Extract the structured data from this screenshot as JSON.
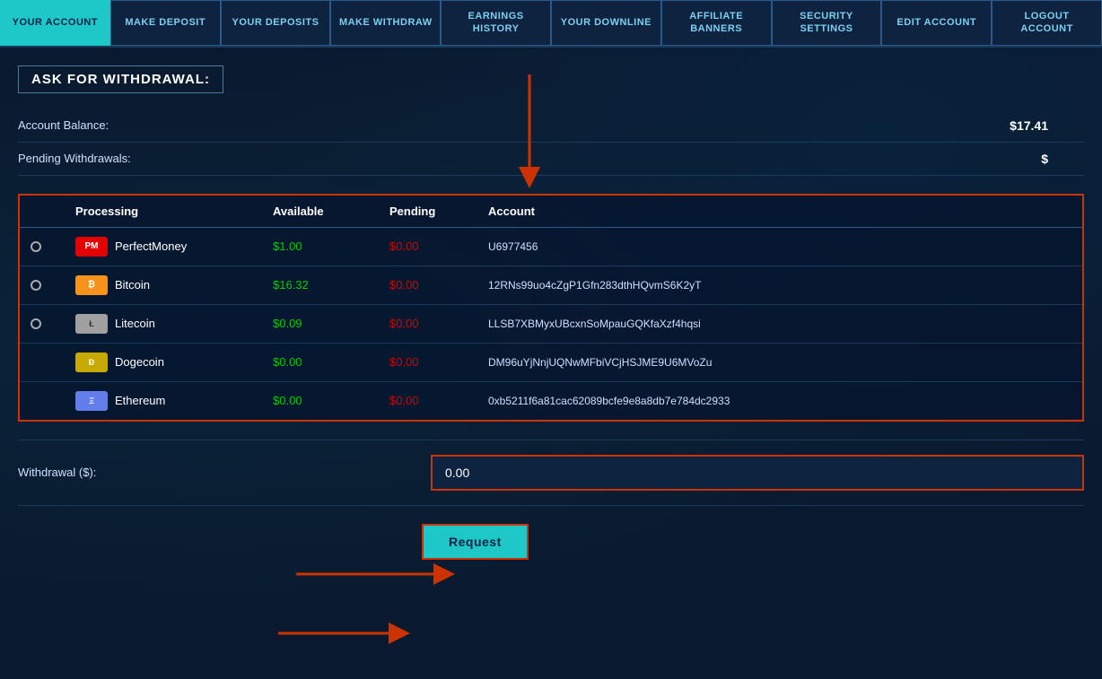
{
  "nav": {
    "items": [
      {
        "id": "your-account",
        "label": "YOUR\nACCOUNT",
        "active": true
      },
      {
        "id": "make-deposit",
        "label": "MAKE\nDEPOSIT",
        "active": false
      },
      {
        "id": "your-deposits",
        "label": "YOUR\nDEPOSITS",
        "active": false
      },
      {
        "id": "make-withdraw",
        "label": "MAKE\nWITHDRAW",
        "active": false
      },
      {
        "id": "earnings-history",
        "label": "EARNINGS\nHISTORY",
        "active": false
      },
      {
        "id": "your-downline",
        "label": "YOUR\nDOWNLINE",
        "active": false
      },
      {
        "id": "affiliate-banners",
        "label": "AFFILIATE\nBANNERS",
        "active": false
      },
      {
        "id": "security-settings",
        "label": "SECURITY\nSETTINGS",
        "active": false
      },
      {
        "id": "edit-account",
        "label": "EDIT\nACCOUNT",
        "active": false
      },
      {
        "id": "logout-account",
        "label": "LOGOUT\nACCOUNT",
        "active": false
      }
    ]
  },
  "page": {
    "section_title": "ASK FOR WITHDRAWAL:",
    "account_balance_label": "Account Balance:",
    "account_balance_value": "$17.41",
    "pending_withdrawals_label": "Pending Withdrawals:",
    "pending_withdrawals_value": "$",
    "table": {
      "headers": [
        "",
        "Processing",
        "Available",
        "Pending",
        "Account"
      ],
      "rows": [
        {
          "radio": true,
          "processor": "PerfectMoney",
          "processor_icon": "PM",
          "icon_type": "pm",
          "available": "$1.00",
          "pending": "$0.00",
          "account": "U6977456"
        },
        {
          "radio": true,
          "processor": "Bitcoin",
          "processor_icon": "BTC",
          "icon_type": "btc",
          "available": "$16.32",
          "pending": "$0.00",
          "account": "12RNs99uo4cZgP1Gfn283dthHQvmS6K2yT"
        },
        {
          "radio": true,
          "processor": "Litecoin",
          "processor_icon": "LTC",
          "icon_type": "ltc",
          "available": "$0.09",
          "pending": "$0.00",
          "account": "LLSB7XBMyxUBcxnSoMpauGQKfaXzf4hqsi"
        },
        {
          "radio": false,
          "processor": "Dogecoin",
          "processor_icon": "DOGE",
          "icon_type": "doge",
          "available": "$0.00",
          "pending": "$0.00",
          "account": "DM96uYjNnjUQNwMFbiVCjHSJME9U6MVoZu"
        },
        {
          "radio": false,
          "processor": "Ethereum",
          "processor_icon": "ETH",
          "icon_type": "eth",
          "available": "$0.00",
          "pending": "$0.00",
          "account": "0xb5211f6a81cac62089bcfe9e8a8db7e784dc2933"
        }
      ]
    },
    "withdrawal_label": "Withdrawal ($):",
    "withdrawal_value": "0.00",
    "request_button": "Request"
  }
}
